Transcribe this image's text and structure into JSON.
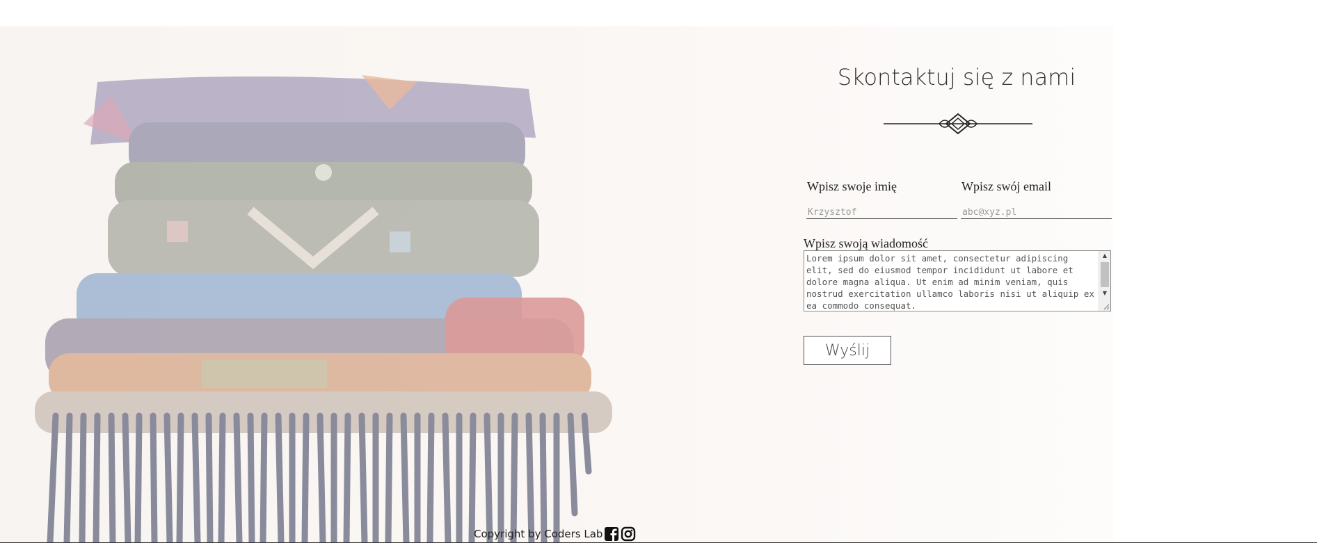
{
  "contact": {
    "title": "Skontaktuj się z nami",
    "name_label": "Wpisz swoje imię",
    "name_placeholder": "Krzysztof",
    "email_label": "Wpisz swój email",
    "email_placeholder": "abc@xyz.pl",
    "message_label": "Wpisz swoją wiadomość",
    "message_value": "Lorem ipsum dolor sit amet, consectetur adipiscing elit, sed do eiusmod tempor incididunt ut labore et dolore magna aliqua. Ut enim ad minim veniam, quis nostrud exercitation ullamco laboris nisi ut aliquip ex ea commodo consequat.",
    "submit_label": "Wyślij"
  },
  "footer": {
    "copyright": "Copyright by Coders Lab",
    "icons": [
      "facebook-icon",
      "instagram-icon"
    ]
  },
  "colors": {
    "text": "#333333",
    "border": "#555555",
    "background": "#f9f5f2"
  }
}
